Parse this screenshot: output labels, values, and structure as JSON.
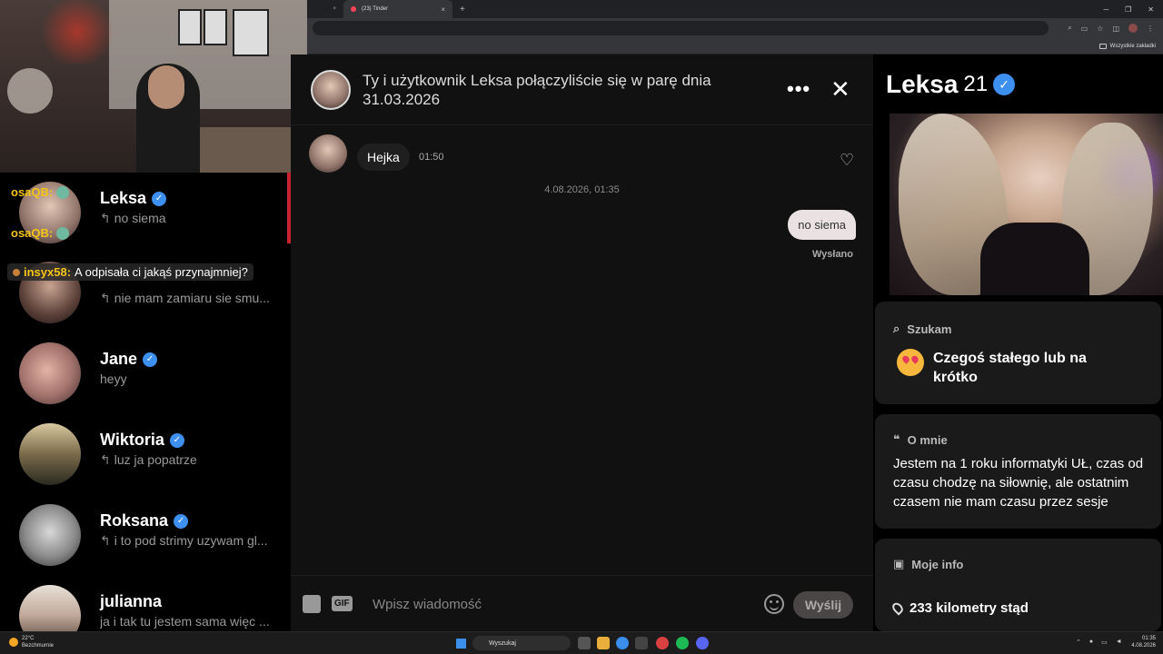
{
  "browser": {
    "tabs": [
      {
        "label": "",
        "close": "×"
      },
      {
        "label": "(23) Tinder",
        "close": "×"
      }
    ],
    "new_tab": "+",
    "window_controls": [
      "─",
      "❐",
      "✕"
    ],
    "bookmarks_label": "Wszystkie zakładki"
  },
  "stream_chat": [
    {
      "user": "osaQB:",
      "message": ""
    },
    {
      "user": "osaQB:",
      "message": ""
    },
    {
      "user": "insyx58:",
      "message": "A odpisała ci jakąś przynajmniej?"
    }
  ],
  "conversations": [
    {
      "name": "Leksa",
      "verified": true,
      "preview": "no siema",
      "replied": true
    },
    {
      "name": "",
      "verified": false,
      "preview": "nie mam zamiaru sie smu...",
      "replied": true
    },
    {
      "name": "Jane",
      "verified": true,
      "preview": "heyy",
      "replied": false
    },
    {
      "name": "Wiktoria",
      "verified": true,
      "preview": "luz ja popatrze",
      "replied": true
    },
    {
      "name": "Roksana",
      "verified": true,
      "preview": "i to pod strimy uzywam gl...",
      "replied": true
    },
    {
      "name": "julianna",
      "verified": false,
      "preview": "ja i tak tu jestem sama więc ...",
      "replied": false
    }
  ],
  "chat": {
    "header": "Ty i użytkownik Leksa połączyliście się w parę dnia 31.03.2026",
    "more_label": "•••",
    "close_label": "✕",
    "incoming": {
      "text": "Hejka",
      "time": "01:50"
    },
    "date_separator": "4.08.2026, 01:35",
    "outgoing": {
      "text": "no siema",
      "status": "Wysłano"
    },
    "composer": {
      "gif_label": "GIF",
      "placeholder": "Wpisz wiadomość",
      "send_label": "Wyślij"
    }
  },
  "profile": {
    "name": "Leksa",
    "age": "21",
    "verified": true,
    "looking_for": {
      "title": "Szukam",
      "value": "Czegoś stałego lub na krótko"
    },
    "about": {
      "title": "O mnie",
      "text": "Jestem na 1 roku informatyki UŁ, czas od czasu chodzę na siłownię, ale ostatnim czasem nie mam czasu przez sesje"
    },
    "info": {
      "title": "Moje info",
      "distance": "233 kilometry stąd"
    }
  },
  "taskbar": {
    "weather_temp": "22°C",
    "weather_desc": "Bezchmurnie",
    "search_label": "Wyszukaj",
    "time": "01:35",
    "date": "4.08.2026"
  },
  "colors": {
    "accent_red": "#c9212d",
    "verified_blue": "#3d8ff0",
    "chat_username": "#f5c518",
    "outgoing_bubble": "#e9e1e2"
  }
}
